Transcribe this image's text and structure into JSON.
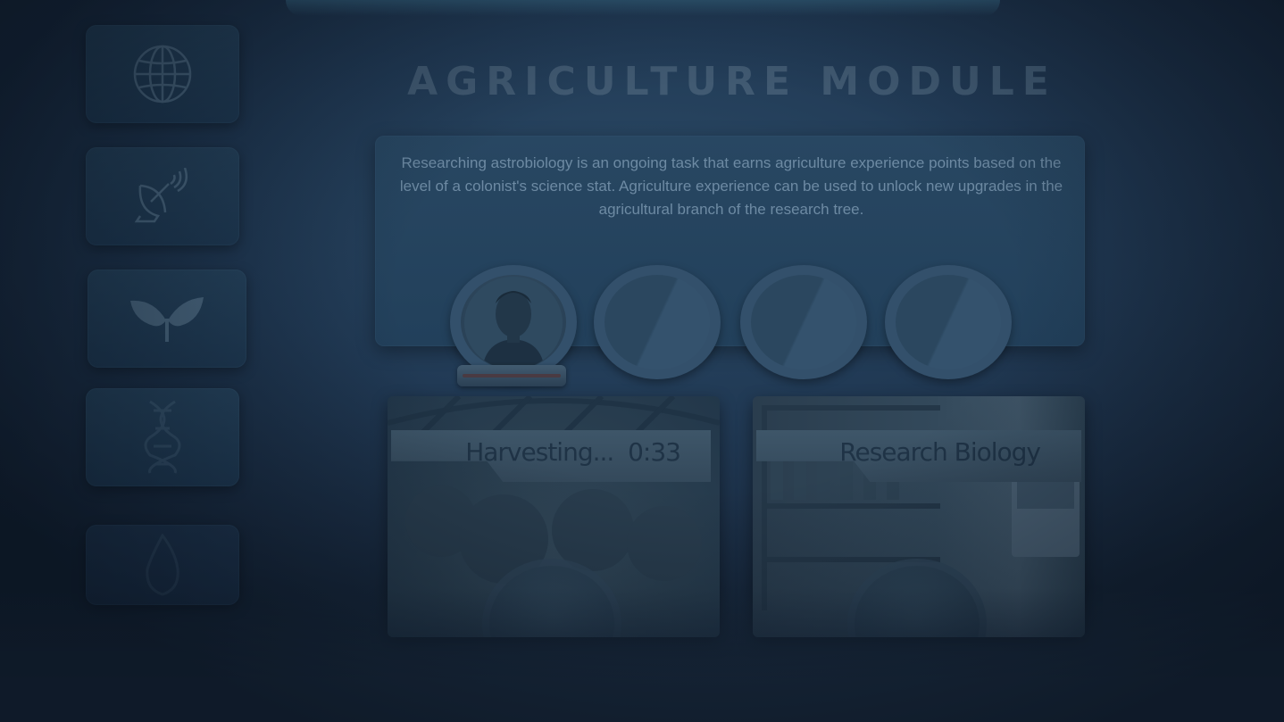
{
  "module": {
    "title": "Agriculture Module",
    "description": "Researching astrobiology is an ongoing task that earns agriculture experience points based on the level of a colonist's science stat. Agriculture experience can be used to unlock new upgrades in the agricultural branch of the research tree."
  },
  "sidebar": {
    "items": [
      {
        "icon": "globe-icon"
      },
      {
        "icon": "satellite-dish-icon"
      },
      {
        "icon": "leaves-icon"
      },
      {
        "icon": "dna-icon"
      },
      {
        "icon": "flame-icon"
      }
    ]
  },
  "colonist_slots": [
    {
      "state": "filled"
    },
    {
      "state": "empty"
    },
    {
      "state": "empty"
    },
    {
      "state": "empty"
    }
  ],
  "tasks": {
    "harvest": {
      "label": "Harvesting...",
      "timer": "0:33"
    },
    "research": {
      "label": "Research Biology"
    }
  },
  "colors": {
    "background": "#213a55",
    "panel": "#284762",
    "text": "#6d8aa3",
    "title": "#415a72"
  }
}
